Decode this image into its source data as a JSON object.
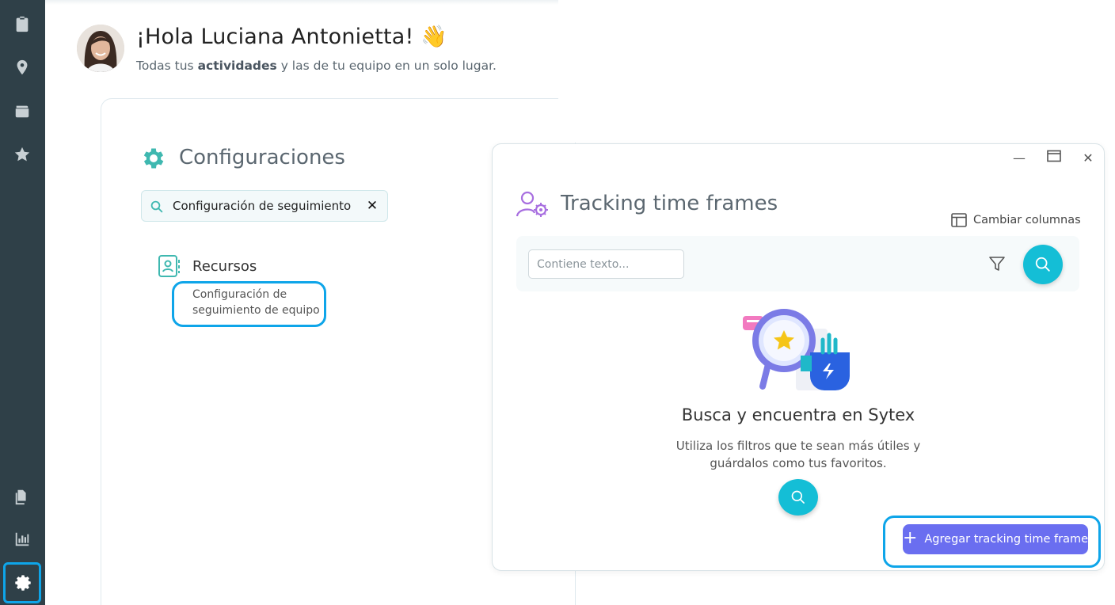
{
  "greeting": {
    "title": "¡Hola Luciana Antonietta! 👋",
    "sub_prefix": "Todas tus",
    "sub_bold": "actividades",
    "sub_suffix": "y las de tu equipo en un solo lugar."
  },
  "sidebar": {
    "items": [
      {
        "icon": "clipboard-icon"
      },
      {
        "icon": "location-pin-icon"
      },
      {
        "icon": "wallet-icon"
      },
      {
        "icon": "star-icon"
      },
      {
        "icon": "documents-icon"
      },
      {
        "icon": "bar-chart-icon"
      },
      {
        "icon": "gear-icon"
      }
    ]
  },
  "config": {
    "title": "Configuraciones",
    "search_value": "Configuración de seguimiento",
    "clear_label": "✕",
    "section_title": "Recursos",
    "section_item": "Configuración de seguimiento de equipo"
  },
  "dialog": {
    "title": "Tracking time frames",
    "change_columns": "Cambiar columnas",
    "filter_placeholder": "Contiene texto...",
    "minimize": "—",
    "maximize": "▭",
    "close": "✕",
    "empty_title": "Busca y encuentra en Sytex",
    "empty_desc": "Utiliza los filtros que te sean más útiles y guárdalos como tus favoritos.",
    "add_button": "Agregar tracking time frame",
    "add_plus": "+"
  },
  "colors": {
    "sidebar": "#2f4048",
    "accent": "#14bed6",
    "primary_button": "#6a6ef0",
    "highlight": "#0ea5e9",
    "teal_icon": "#3fb8b0"
  }
}
